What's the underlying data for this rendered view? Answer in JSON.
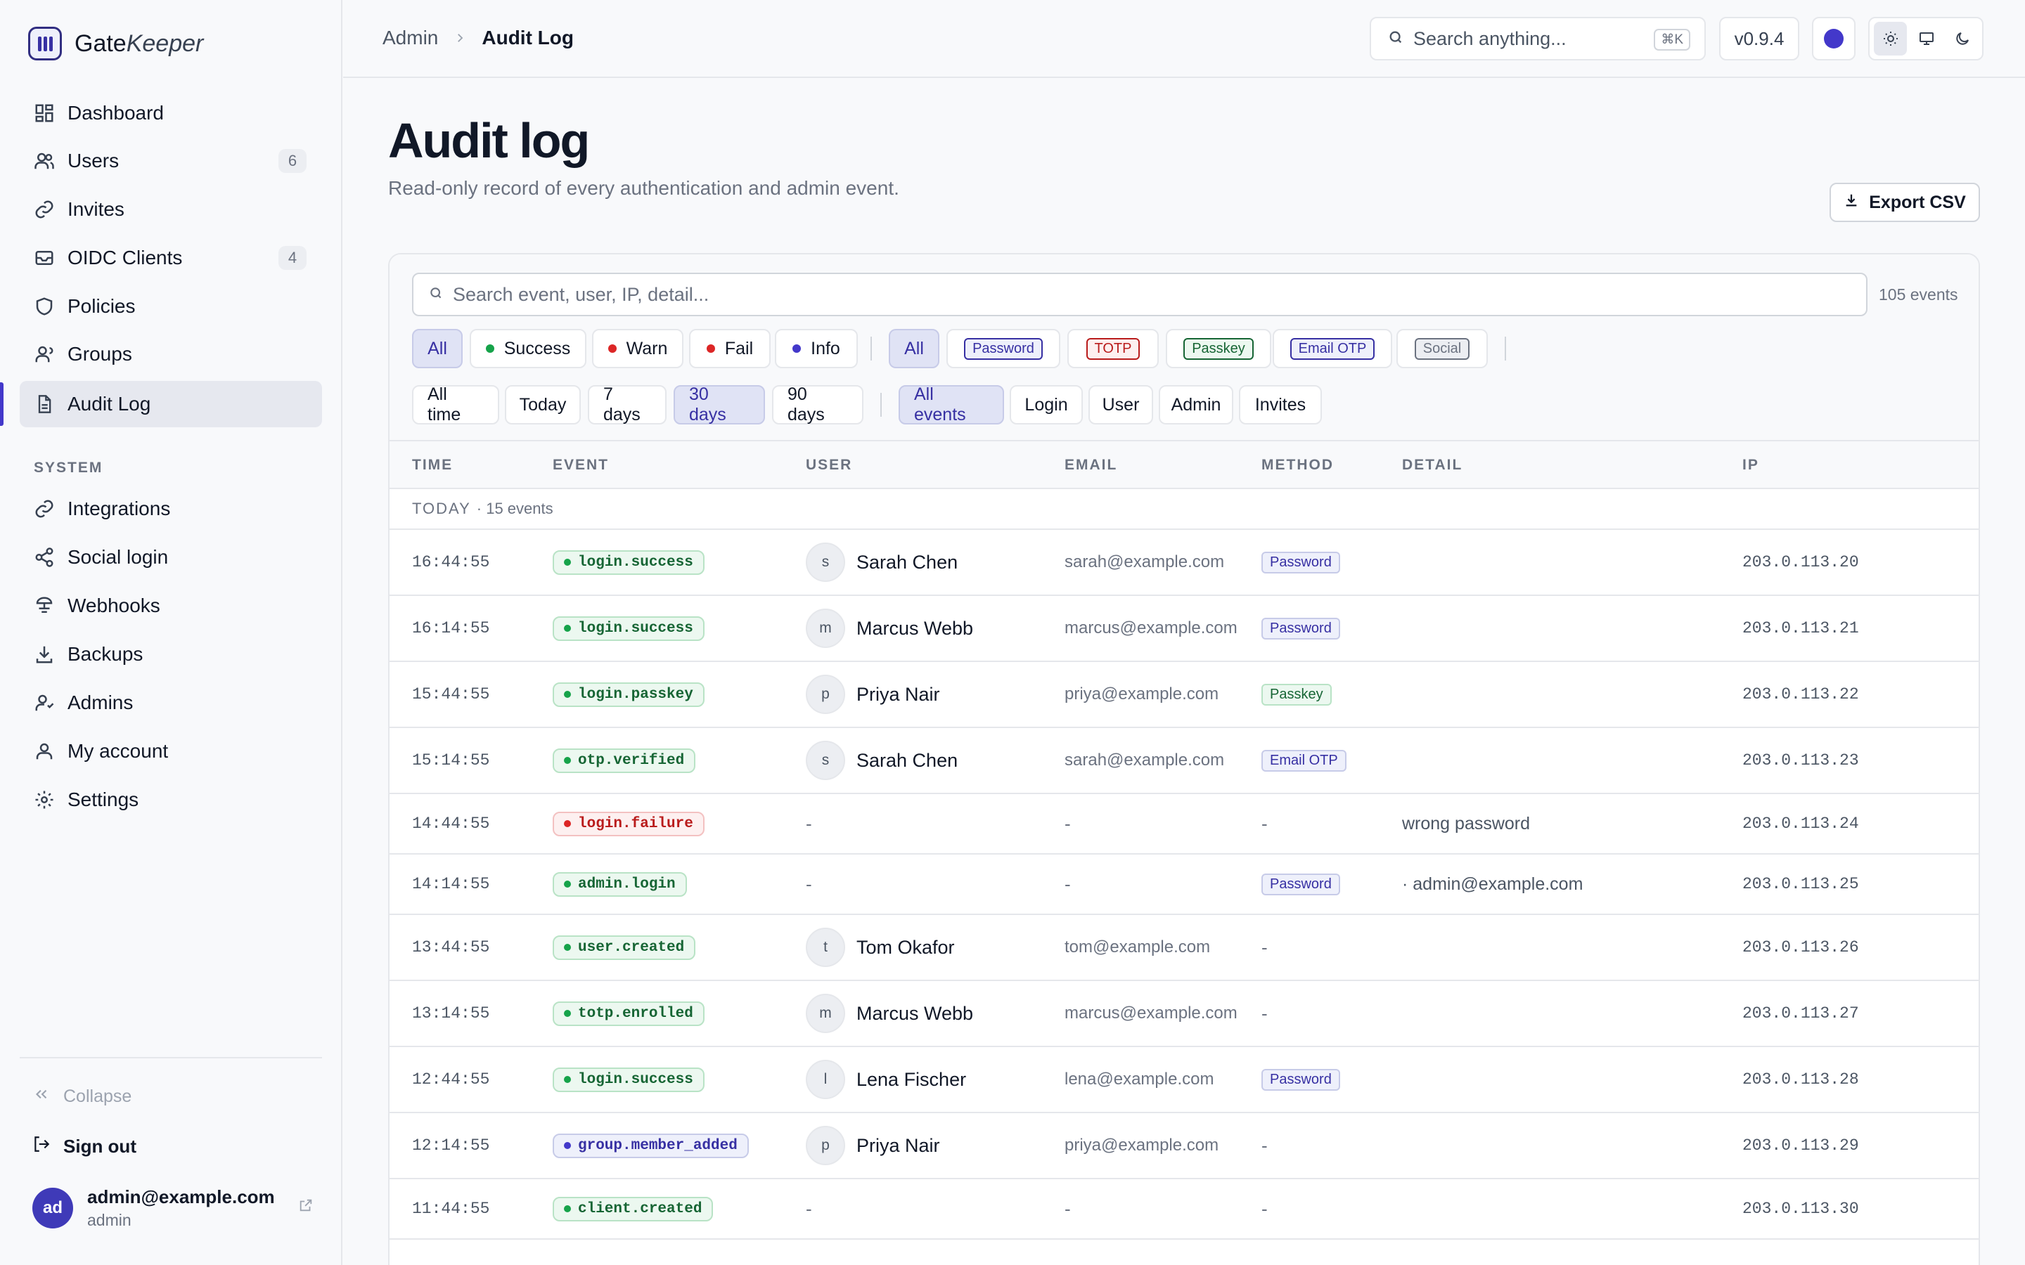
{
  "app": {
    "brand_a": "Gate",
    "brand_b": "Keeper"
  },
  "sidebar": {
    "items": [
      {
        "label": "Dashboard",
        "icon": "dashboard-icon"
      },
      {
        "label": "Users",
        "count": "6",
        "icon": "users-icon"
      },
      {
        "label": "Invites",
        "icon": "link-icon"
      },
      {
        "label": "OIDC Clients",
        "count": "4",
        "icon": "mail-icon"
      },
      {
        "label": "Policies",
        "icon": "shield-icon"
      },
      {
        "label": "Groups",
        "icon": "group-icon"
      },
      {
        "label": "Audit Log",
        "icon": "document-icon",
        "active": true
      }
    ],
    "system_label": "SYSTEM",
    "system_items": [
      {
        "label": "Integrations",
        "icon": "link-icon"
      },
      {
        "label": "Social login",
        "icon": "share-icon"
      },
      {
        "label": "Webhooks",
        "icon": "webhook-icon"
      },
      {
        "label": "Backups",
        "icon": "download-icon"
      },
      {
        "label": "Admins",
        "icon": "admin-icon"
      },
      {
        "label": "My account",
        "icon": "user-icon"
      },
      {
        "label": "Settings",
        "icon": "gear-icon"
      }
    ],
    "collapse_label": "Collapse",
    "signout_label": "Sign out",
    "user": {
      "initials": "ad",
      "email": "admin@example.com",
      "role": "admin"
    }
  },
  "topbar": {
    "breadcrumb": [
      "Admin",
      "Audit Log"
    ],
    "search_placeholder": "Search anything...",
    "search_shortcut": "⌘K",
    "version": "v0.9.4"
  },
  "page": {
    "title": "Audit log",
    "subtitle": "Read-only record of every authentication and admin event.",
    "export_label": "Export CSV"
  },
  "filters": {
    "search_placeholder": "Search event, user, IP, detail...",
    "count_text": "105 events",
    "status": [
      "All",
      "Success",
      "Warn",
      "Fail",
      "Info"
    ],
    "methods": [
      "All",
      "Password",
      "TOTP",
      "Passkey",
      "Email OTP",
      "Social"
    ],
    "ranges": [
      "All time",
      "Today",
      "7 days",
      "30 days",
      "90 days"
    ],
    "types": [
      "All events",
      "Login",
      "User",
      "Admin",
      "Invites"
    ],
    "selected": {
      "status": "All",
      "method": "All",
      "range": "30 days",
      "type": "All events"
    }
  },
  "table": {
    "columns": [
      "TIME",
      "EVENT",
      "USER",
      "EMAIL",
      "METHOD",
      "DETAIL",
      "IP"
    ],
    "group_label": "TODAY",
    "group_count": "· 15 events",
    "rows": [
      {
        "time": "16:44:55",
        "event": "login.success",
        "status": "ok",
        "initial": "s",
        "user": "Sarah Chen",
        "email": "sarah@example.com",
        "method": "Password",
        "detail": "",
        "ip": "203.0.113.20"
      },
      {
        "time": "16:14:55",
        "event": "login.success",
        "status": "ok",
        "initial": "m",
        "user": "Marcus Webb",
        "email": "marcus@example.com",
        "method": "Password",
        "detail": "",
        "ip": "203.0.113.21"
      },
      {
        "time": "15:44:55",
        "event": "login.passkey",
        "status": "ok",
        "initial": "p",
        "user": "Priya Nair",
        "email": "priya@example.com",
        "method": "Passkey",
        "detail": "",
        "ip": "203.0.113.22"
      },
      {
        "time": "15:14:55",
        "event": "otp.verified",
        "status": "ok",
        "initial": "s",
        "user": "Sarah Chen",
        "email": "sarah@example.com",
        "method": "Email OTP",
        "detail": "",
        "ip": "203.0.113.23"
      },
      {
        "time": "14:44:55",
        "event": "login.failure",
        "status": "fail",
        "initial": "",
        "user": "-",
        "email": "-",
        "method": "-",
        "detail": "wrong password",
        "ip": "203.0.113.24"
      },
      {
        "time": "14:14:55",
        "event": "admin.login",
        "status": "ok",
        "initial": "",
        "user": "-",
        "email": "-",
        "method": "Password",
        "detail": "· admin@example.com",
        "ip": "203.0.113.25"
      },
      {
        "time": "13:44:55",
        "event": "user.created",
        "status": "ok",
        "initial": "t",
        "user": "Tom Okafor",
        "email": "tom@example.com",
        "method": "-",
        "detail": "",
        "ip": "203.0.113.26"
      },
      {
        "time": "13:14:55",
        "event": "totp.enrolled",
        "status": "ok",
        "initial": "m",
        "user": "Marcus Webb",
        "email": "marcus@example.com",
        "method": "-",
        "detail": "",
        "ip": "203.0.113.27"
      },
      {
        "time": "12:44:55",
        "event": "login.success",
        "status": "ok",
        "initial": "l",
        "user": "Lena Fischer",
        "email": "lena@example.com",
        "method": "Password",
        "detail": "",
        "ip": "203.0.113.28"
      },
      {
        "time": "12:14:55",
        "event": "group.member_added",
        "status": "info",
        "initial": "p",
        "user": "Priya Nair",
        "email": "priya@example.com",
        "method": "-",
        "detail": "",
        "ip": "203.0.113.29"
      },
      {
        "time": "11:44:55",
        "event": "client.created",
        "status": "ok",
        "initial": "",
        "user": "-",
        "email": "-",
        "method": "-",
        "detail": "",
        "ip": "203.0.113.30"
      }
    ]
  }
}
